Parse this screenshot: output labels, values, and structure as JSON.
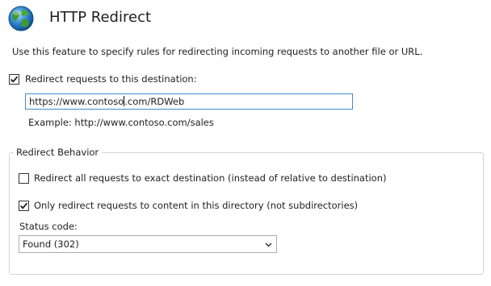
{
  "header": {
    "title": "HTTP Redirect",
    "icon": "globe-icon",
    "description": "Use this feature to specify rules for redirecting incoming requests to another file or URL."
  },
  "redirect": {
    "checkbox_label": "Redirect requests to this destination:",
    "checked": true,
    "destination_prefix": "https://www.contoso",
    "destination_suffix": ".com/RDWeb",
    "example": "Example: http://www.contoso.com/sales"
  },
  "behavior": {
    "legend": "Redirect Behavior",
    "exact_label": "Redirect all requests to exact destination (instead of relative to destination)",
    "exact_checked": false,
    "directory_only_label": "Only redirect requests to content in this directory (not subdirectories)",
    "directory_only_checked": true,
    "status_label": "Status code:",
    "status_value": "Found (302)"
  },
  "colors": {
    "input_focus_border": "#3c8ccd",
    "group_border": "#d3d3d3",
    "text": "#1e1e1e"
  }
}
